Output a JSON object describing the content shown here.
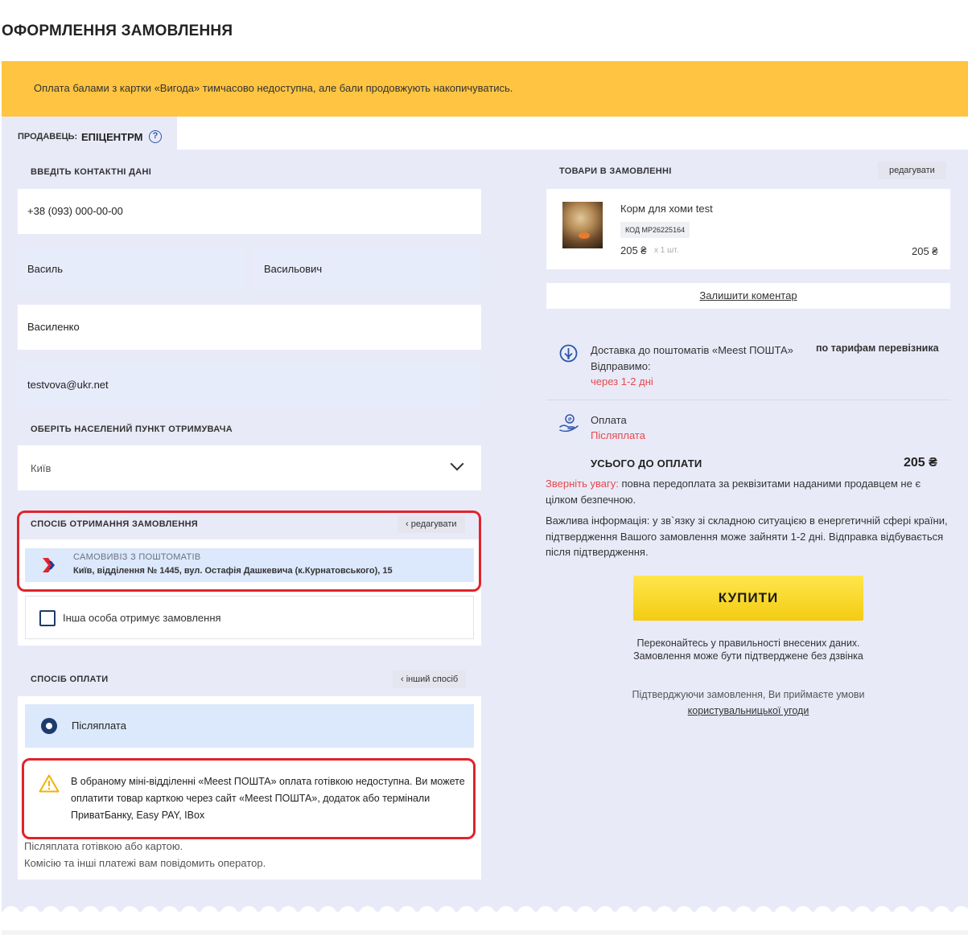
{
  "page": {
    "title": "ОФОРМЛЕННЯ ЗАМОВЛЕННЯ"
  },
  "notice": {
    "text": "Оплата балами з картки «Вигода» тимчасово недоступна, але бали продовжують накопичуватись."
  },
  "seller": {
    "label": "ПРОДАВЕЦЬ:",
    "name": "ЕПІЦЕНТРМ",
    "help": "?"
  },
  "contacts": {
    "title": "ВВЕДІТЬ КОНТАКТНІ ДАНІ",
    "phone": "+38 (093) 000-00-00",
    "first_name": "Василь",
    "middle_name": "Васильович",
    "last_name": "Василенко",
    "email": "testvova@ukr.net"
  },
  "city": {
    "title": "ОБЕРІТЬ НАСЕЛЕНИЙ ПУНКТ ОТРИМУВАЧА",
    "value": "Київ"
  },
  "delivery": {
    "title": "СПОСІБ ОТРИМАННЯ ЗАМОВЛЕННЯ",
    "edit": "‹ редагувати",
    "method": "САМОВИВІЗ З ПОШТОМАТІВ",
    "address": "Київ, відділення № 1445, вул. Остафія Дашкевича (к.Курнатовського), 15",
    "other_person": "Інша особа отримує замовлення"
  },
  "payment": {
    "title": "СПОСІБ ОПЛАТИ",
    "other": "‹ інший спосіб",
    "option": "Післяплата",
    "warning": "В обраному міні-відділенні «Meest ПОШТА» оплата готівкою недоступна. Ви можете оплатити товар карткою через сайт «Meest ПОШТА», додаток або термінали ПриватБанку, Easy PAY, IBox",
    "note1": "Післяплата готівкою або картою.",
    "note2": "Комісію та інші платежі вам повідомить оператор."
  },
  "cart": {
    "title": "ТОВАРИ В ЗАМОВЛЕННІ",
    "edit": "редагувати",
    "item": {
      "name": "Корм для хоми test",
      "code": "КОД MP26225164",
      "price": "205 ₴",
      "qty": "x 1 шт.",
      "total": "205 ₴"
    },
    "comment": "Залишити коментар"
  },
  "summary": {
    "delivery_label": "Доставка до поштоматів «Meest ПОШТА»",
    "delivery_tariff": "по тарифам перевізника",
    "ship_label": "Відправимо:",
    "ship_time": "через 1-2 дні",
    "pay_label": "Оплата",
    "pay_value": "Післяплата",
    "total_label": "УСЬОГО ДО ОПЛАТИ",
    "total_value": "205 ₴",
    "attention": "Зверніть увагу:",
    "attention_text": " повна передоплата за реквізитами наданими продавцем не є цілком безпечною.",
    "important": "Важлива інформація: у зв`язку зі складною ситуацією в енергетичній сфері країни, підтвердження Вашого замовлення може зайняти 1-2 дні. Відправка відбувається після підтвердження.",
    "buy": "КУПИТИ",
    "confirm1": "Переконайтесь у правильності внесених даних.",
    "confirm2": "Замовлення може бути підтверджене без дзвінка",
    "agree": "Підтверджуючи замовлення, Ви приймаєте умови",
    "agree_link": "користувальницької угоди"
  },
  "colors": {
    "notice": "#ffc441",
    "panel": "#e9eaf8",
    "buy": "#f3cc12",
    "highlight": "#e0242b",
    "accent": "#1d3b6e"
  },
  "icons": [
    "help-icon",
    "chevron-down-icon",
    "meest-logo-icon",
    "warning-icon",
    "delivery-pin-icon",
    "payment-hand-icon"
  ]
}
